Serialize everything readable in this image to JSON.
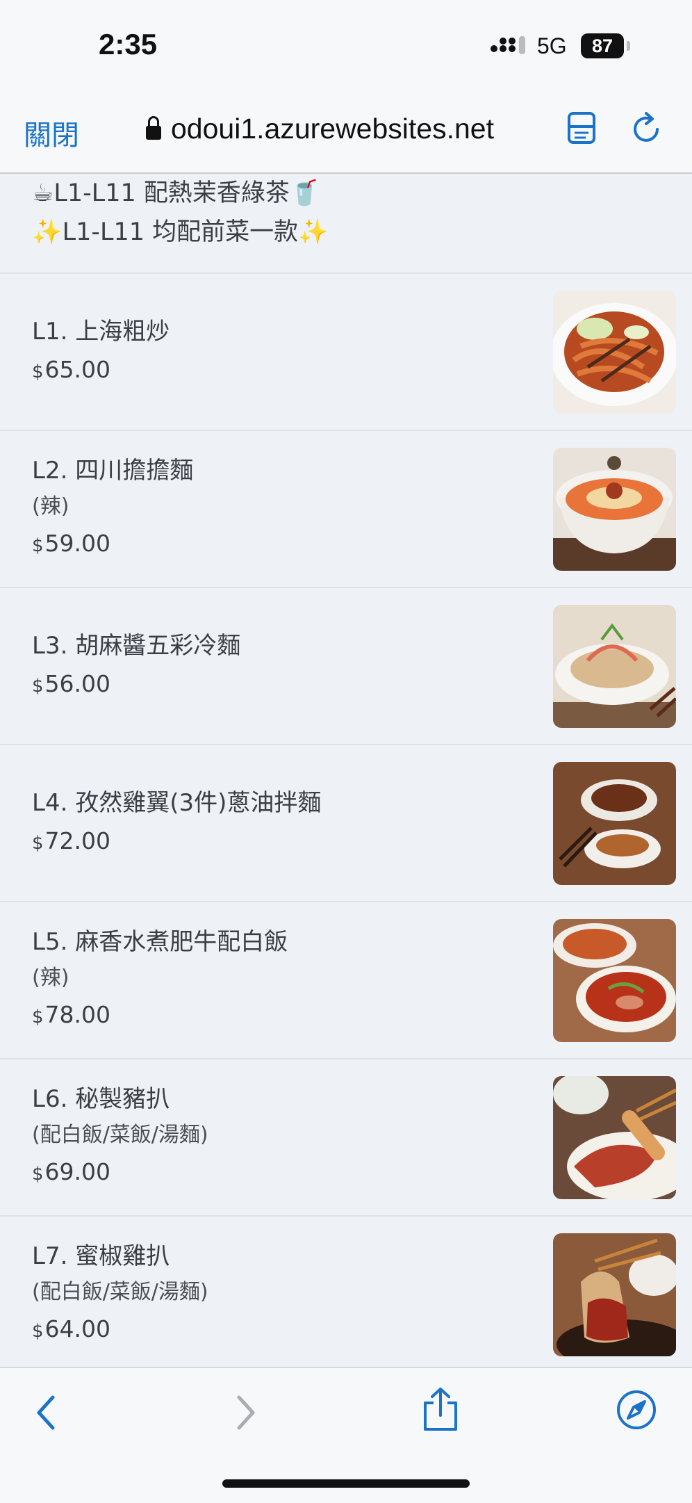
{
  "status_bar": {
    "time": "2:35",
    "network": "5G",
    "battery": "87"
  },
  "browser": {
    "close_label": "關閉",
    "url": "odoui1.azurewebsites.net"
  },
  "notice": {
    "line1": "☕L1-L11 配熱茉香綠茶🥤",
    "line2": "✨L1-L11 均配前菜一款✨"
  },
  "menu_items": [
    {
      "name": "L1. 上海粗炒",
      "note": "",
      "currency": "$",
      "price": "65.00"
    },
    {
      "name": "L2. 四川擔擔麵",
      "note": "(辣)",
      "currency": "$",
      "price": "59.00"
    },
    {
      "name": "L3. 胡麻醬五彩冷麵",
      "note": "",
      "currency": "$",
      "price": "56.00"
    },
    {
      "name": "L4. 孜然雞翼(3件)蔥油拌麵",
      "note": "",
      "currency": "$",
      "price": "72.00"
    },
    {
      "name": "L5. 麻香水煮肥牛配白飯",
      "note": "(辣)",
      "currency": "$",
      "price": "78.00"
    },
    {
      "name": "L6. 秘製豬扒",
      "note": "(配白飯/菜飯/湯麵)",
      "currency": "$",
      "price": "69.00"
    },
    {
      "name": "L7. 蜜椒雞扒",
      "note": "(配白飯/菜飯/湯麵)",
      "currency": "$",
      "price": "64.00"
    }
  ],
  "colors": {
    "accent": "#1a73c9",
    "background": "#eef2f6",
    "text": "#3a3f45"
  },
  "icons": {
    "back": "chevron-left-icon",
    "forward": "chevron-right-icon",
    "share": "share-icon",
    "safari": "compass-icon",
    "reader": "reader-icon",
    "reload": "reload-icon"
  }
}
